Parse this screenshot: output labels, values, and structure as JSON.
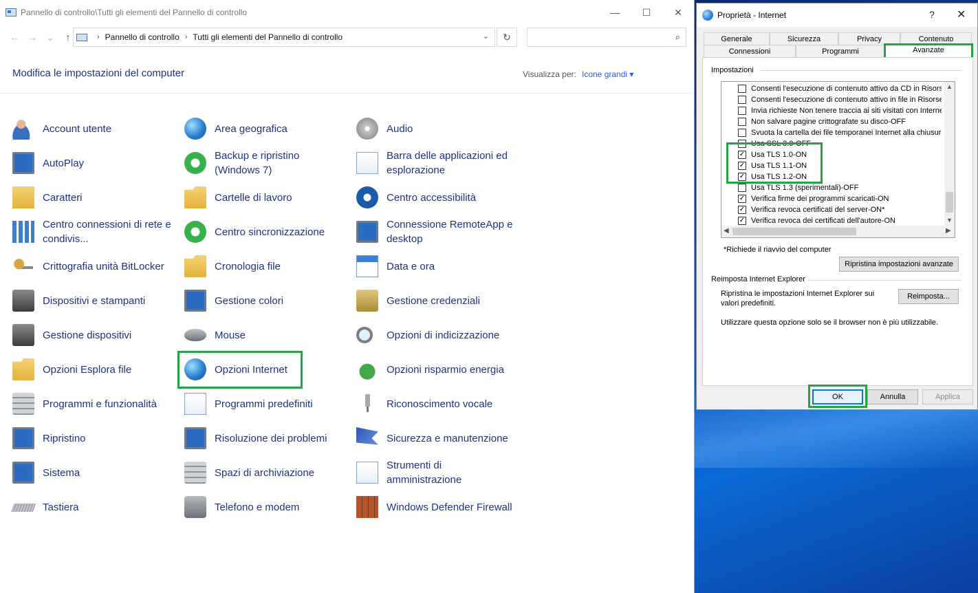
{
  "control_panel": {
    "window_title": "Pannello di controllo\\Tutti gli elementi del Pannello di controllo",
    "window_controls": {
      "minimize": "—",
      "maximize": "☐",
      "close": "✕"
    },
    "nav": {
      "back": "←",
      "forward": "→",
      "recent": "⌄",
      "up": "↑"
    },
    "address": {
      "crumb1": "Pannello di controllo",
      "crumb2": "Tutti gli elementi del Pannello di controllo",
      "sep": "›",
      "dropdown": "⌄"
    },
    "refresh": "↻",
    "search": {
      "placeholder": "",
      "icon": "⌕"
    },
    "page_title": "Modifica le impostazioni del computer",
    "view_by_label": "Visualizza per:",
    "view_by_value": "Icone grandi ▾",
    "items": [
      {
        "label": "Account utente",
        "icon": "ic-person"
      },
      {
        "label": "Area geografica",
        "icon": "ic-globe"
      },
      {
        "label": "Audio",
        "icon": "ic-disc"
      },
      {
        "label": "AutoPlay",
        "icon": "ic-monitor"
      },
      {
        "label": "Backup e ripristino (Windows 7)",
        "icon": "ic-green"
      },
      {
        "label": "Barra delle applicazioni ed esplorazione",
        "icon": "ic-doc"
      },
      {
        "label": "Caratteri",
        "icon": "ic-letter"
      },
      {
        "label": "Cartelle di lavoro",
        "icon": "ic-folder"
      },
      {
        "label": "Centro accessibilità",
        "icon": "ic-blue-circle"
      },
      {
        "label": "Centro connessioni di rete e condivis...",
        "icon": "ic-net"
      },
      {
        "label": "Centro sincronizzazione",
        "icon": "ic-green"
      },
      {
        "label": "Connessione RemoteApp e desktop",
        "icon": "ic-monitor"
      },
      {
        "label": "Crittografia unità BitLocker",
        "icon": "ic-key"
      },
      {
        "label": "Cronologia file",
        "icon": "ic-folder"
      },
      {
        "label": "Data e ora",
        "icon": "ic-cal"
      },
      {
        "label": "Dispositivi e stampanti",
        "icon": "ic-printer"
      },
      {
        "label": "Gestione colori",
        "icon": "ic-monitor"
      },
      {
        "label": "Gestione credenziali",
        "icon": "ic-vault"
      },
      {
        "label": "Gestione dispositivi",
        "icon": "ic-printer"
      },
      {
        "label": "Mouse",
        "icon": "ic-mouse"
      },
      {
        "label": "Opzioni di indicizzazione",
        "icon": "ic-magnify"
      },
      {
        "label": "Opzioni Esplora file",
        "icon": "ic-folder"
      },
      {
        "label": "Opzioni Internet",
        "icon": "ic-globe"
      },
      {
        "label": "Opzioni risparmio energia",
        "icon": "ic-battery"
      },
      {
        "label": "Programmi e funzionalità",
        "icon": "ic-server"
      },
      {
        "label": "Programmi predefiniti",
        "icon": "ic-check"
      },
      {
        "label": "Riconoscimento vocale",
        "icon": "ic-mic"
      },
      {
        "label": "Ripristino",
        "icon": "ic-monitor"
      },
      {
        "label": "Risoluzione dei problemi",
        "icon": "ic-monitor"
      },
      {
        "label": "Sicurezza e manutenzione",
        "icon": "ic-flag"
      },
      {
        "label": "Sistema",
        "icon": "ic-monitor"
      },
      {
        "label": "Spazi di archiviazione",
        "icon": "ic-server"
      },
      {
        "label": "Strumenti di amministrazione",
        "icon": "ic-doc"
      },
      {
        "label": "Tastiera",
        "icon": "ic-keyboard"
      },
      {
        "label": "Telefono e modem",
        "icon": "ic-phone"
      },
      {
        "label": "Windows Defender Firewall",
        "icon": "ic-wall"
      }
    ]
  },
  "dialog": {
    "title": "Proprietà - Internet",
    "help": "?",
    "close": "✕",
    "tabs_row1": [
      "Generale",
      "Sicurezza",
      "Privacy",
      "Contenuto"
    ],
    "tabs_row2": [
      "Connessioni",
      "Programmi",
      "Avanzate"
    ],
    "active_tab": "Avanzate",
    "settings_group": "Impostazioni",
    "options": [
      {
        "label": "Consenti l'esecuzione di contenuto attivo da CD in Risorse",
        "checked": false
      },
      {
        "label": "Consenti l'esecuzione di contenuto attivo in file in Risorse",
        "checked": false
      },
      {
        "label": "Invia richieste Non tenere traccia ai siti visitati con Interne",
        "checked": false
      },
      {
        "label": "Non salvare pagine crittografate su disco-OFF",
        "checked": false
      },
      {
        "label": "Svuota la cartella dei file temporanei Internet alla chiusura",
        "checked": false
      },
      {
        "label": "Usa SSL 3.0-OFF",
        "checked": false
      },
      {
        "label": "Usa TLS 1.0-ON",
        "checked": true
      },
      {
        "label": "Usa TLS 1.1-ON",
        "checked": true
      },
      {
        "label": "Usa TLS 1.2-ON",
        "checked": true
      },
      {
        "label": "Usa TLS 1.3 (sperimentali)-OFF",
        "checked": false
      },
      {
        "label": "Verifica firme dei programmi scaricati-ON",
        "checked": true
      },
      {
        "label": "Verifica revoca certificati del server-ON*",
        "checked": true
      },
      {
        "label": "Verifica revoca dei certificati dell'autore-ON",
        "checked": true
      }
    ],
    "check_mark": "✓",
    "restart_note": "*Richiede il riavvio del computer",
    "restore_advanced": "Ripristina impostazioni avanzate",
    "reset_group": "Reimposta Internet Explorer",
    "reset_desc": "Ripristina le impostazioni Internet Explorer sui valori predefiniti.",
    "reset_button": "Reimposta...",
    "reset_note": "Utilizzare questa opzione solo se il browser non è più utilizzabile.",
    "ok": "OK",
    "cancel": "Annulla",
    "apply": "Applica",
    "scroll": {
      "up": "▲",
      "down": "▼",
      "left": "◀",
      "right": "▶"
    }
  }
}
